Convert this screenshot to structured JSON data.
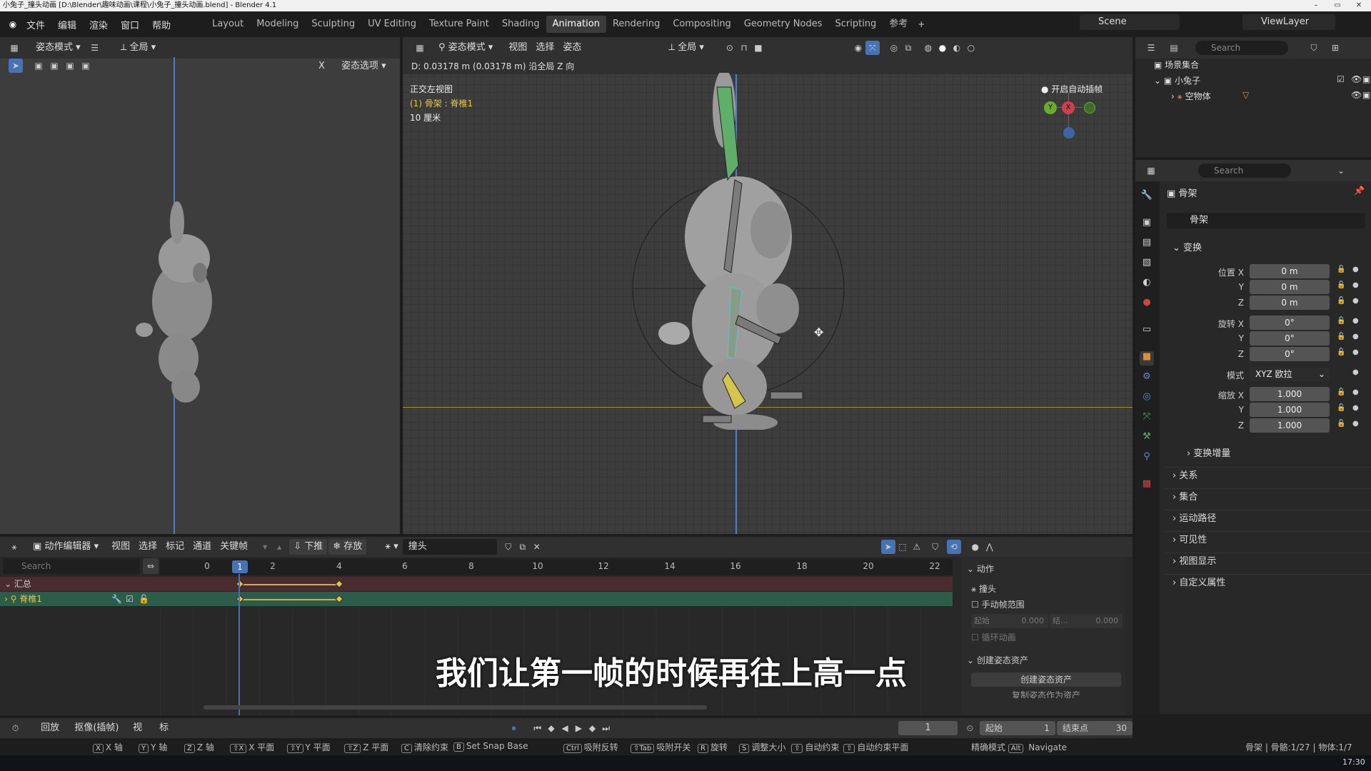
{
  "window": {
    "title": "小兔子_撞头动画 [D:\\Blender\\趣味动画\\课程\\小兔子_撞头动画.blend] - Blender 4.1"
  },
  "menu": [
    "文件",
    "编辑",
    "渲染",
    "窗口",
    "帮助"
  ],
  "workspaces": [
    "Layout",
    "Modeling",
    "Sculpting",
    "UV Editing",
    "Texture Paint",
    "Shading",
    "Animation",
    "Rendering",
    "Compositing",
    "Geometry Nodes",
    "Scripting",
    "参考"
  ],
  "active_workspace": "Animation",
  "scene": "Scene",
  "view_layer": "ViewLayer",
  "left_view": {
    "mode": "姿态模式",
    "orientation": "全局",
    "options": "姿态选项",
    "axis_x": "X"
  },
  "main_view": {
    "mode": "姿态模式",
    "menus": [
      "视图",
      "选择",
      "姿态"
    ],
    "orientation": "全局",
    "status_line": "D: 0.03178 m (0.03178 m) 沿全局 Z 向",
    "view_name": "正交左视图",
    "active_bone": "(1) 骨架 : 脊椎1",
    "scale": "10 厘米",
    "auto_keying": "开启自动插帧"
  },
  "outliner": {
    "search_placeholder": "Search",
    "root": "场景集合",
    "collection": "小兔子",
    "object": "空物体"
  },
  "properties": {
    "search_placeholder": "Search",
    "object_name": "骨架",
    "data_name": "骨架",
    "transform_header": "变换",
    "location_label": "位置",
    "rotation_label": "旋转",
    "scale_label": "缩放",
    "loc": {
      "x": "0 m",
      "y": "0 m",
      "z": "0 m"
    },
    "rot": {
      "x": "0°",
      "y": "0°",
      "z": "0°"
    },
    "mode_label": "模式",
    "mode_value": "XYZ 欧拉",
    "scl": {
      "x": "1.000",
      "y": "1.000",
      "z": "1.000"
    },
    "axis": {
      "x": "X",
      "y": "Y",
      "z": "Z"
    },
    "sections": [
      "变换增量",
      "关系",
      "集合",
      "运动路径",
      "可见性",
      "视图显示",
      "自定义属性"
    ]
  },
  "action_editor": {
    "editor_name": "动作编辑器",
    "menus": [
      "视图",
      "选择",
      "标记",
      "通道",
      "关键帧"
    ],
    "push_down": "下推",
    "stash": "存放",
    "action": "撞头",
    "search_placeholder": "Search",
    "current_frame_badge": "1",
    "ticks": [
      "0",
      "2",
      "4",
      "6",
      "8",
      "10",
      "12",
      "14",
      "16",
      "18",
      "20",
      "22"
    ],
    "channels": [
      "汇总",
      "脊椎1"
    ],
    "keyframes": [
      1,
      4
    ],
    "sidebar": {
      "action_header": "动作",
      "action_name": "撞头",
      "manual_range": "手动帧范围",
      "start_label": "起始",
      "start_val": "0.000",
      "end_label": "结...",
      "end_val": "0.000",
      "cyclic": "循环动画",
      "pose_assets_header": "创建姿态资产",
      "create_pose": "创建姿态资产",
      "copy_pose": "复制姿态作为资产"
    }
  },
  "subtitle": "我们让第一帧的时候再往上高一点",
  "timeline": {
    "playback": "回放",
    "keying": "抠像(插帧)",
    "view": "视图",
    "marker": "标记",
    "frame": "1",
    "start_label": "起始",
    "start": "1",
    "end_label": "结束点",
    "end": "30"
  },
  "statusbar": {
    "hints": [
      [
        "X",
        "X 轴"
      ],
      [
        "Y",
        "Y 轴"
      ],
      [
        "Z",
        "Z 轴"
      ],
      [
        "⇧X",
        "X 平面"
      ],
      [
        "⇧Y",
        "Y 平面"
      ],
      [
        "⇧Z",
        "Z 平面"
      ],
      [
        "C",
        "清除约束"
      ],
      [
        "B",
        "Set Snap Base"
      ],
      [
        "Ctrl",
        "吸附反转"
      ],
      [
        "⇧Tab",
        "吸附开关"
      ],
      [
        "R",
        "旋转"
      ],
      [
        "S",
        "调整大小"
      ],
      [
        "⇧",
        "自动约束"
      ],
      [
        "⇧",
        "自动约束平面"
      ]
    ],
    "precision": "精确模式",
    "alt": "Alt",
    "navigate": "Navigate",
    "right_info": "骨架 | 骨骼:1/27 | 物体:1/7",
    "clock": "17:30"
  },
  "colors": {
    "accent": "#4772b3",
    "keyframe": "#e3c44a",
    "active_channel": "#2c5d4b",
    "summary_channel": "#4a2b2f",
    "timeline_current": "#4772b3"
  }
}
